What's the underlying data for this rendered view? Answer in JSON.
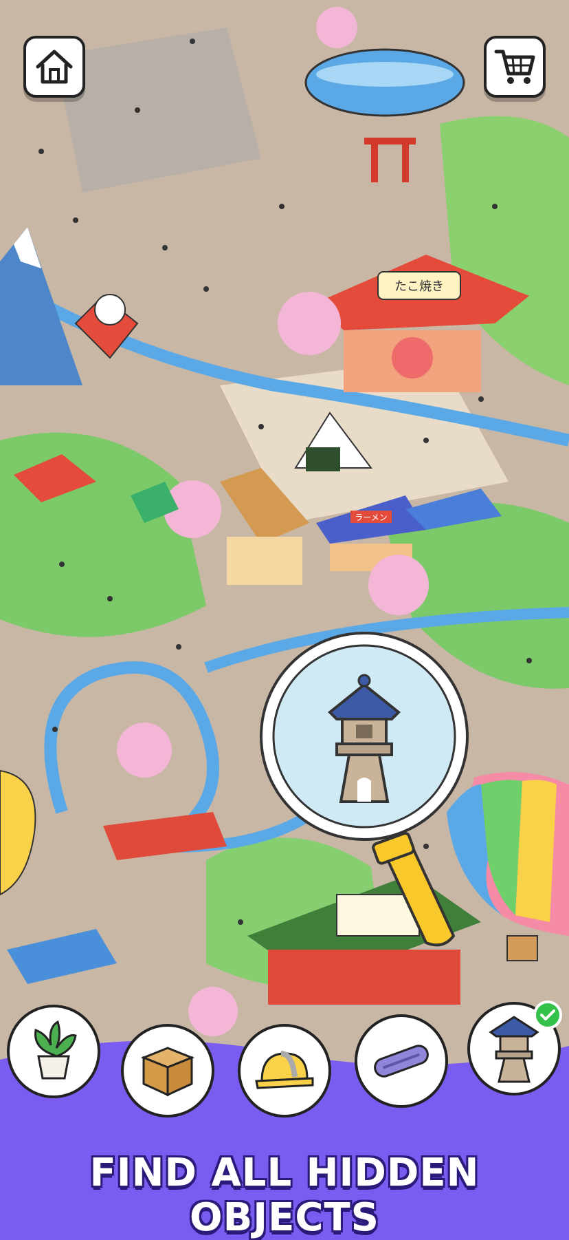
{
  "header": {
    "home_icon": "home-icon",
    "cart_icon": "shopping-cart-icon"
  },
  "scene": {
    "banner_sign": "たこ焼き",
    "ramen_sign": "ラーメン"
  },
  "magnifier": {
    "target_icon": "stone-lantern-icon"
  },
  "item_bar": {
    "items": [
      {
        "name": "potted-plant",
        "found": false
      },
      {
        "name": "cardboard-box",
        "found": false
      },
      {
        "name": "hard-hat",
        "found": false
      },
      {
        "name": "skateboard",
        "found": false
      },
      {
        "name": "stone-lantern",
        "found": true
      }
    ]
  },
  "caption": "FIND ALL HIDDEN OBJECTS",
  "colors": {
    "bar_purple": "#7a5cf0",
    "check_green": "#35c24a"
  }
}
